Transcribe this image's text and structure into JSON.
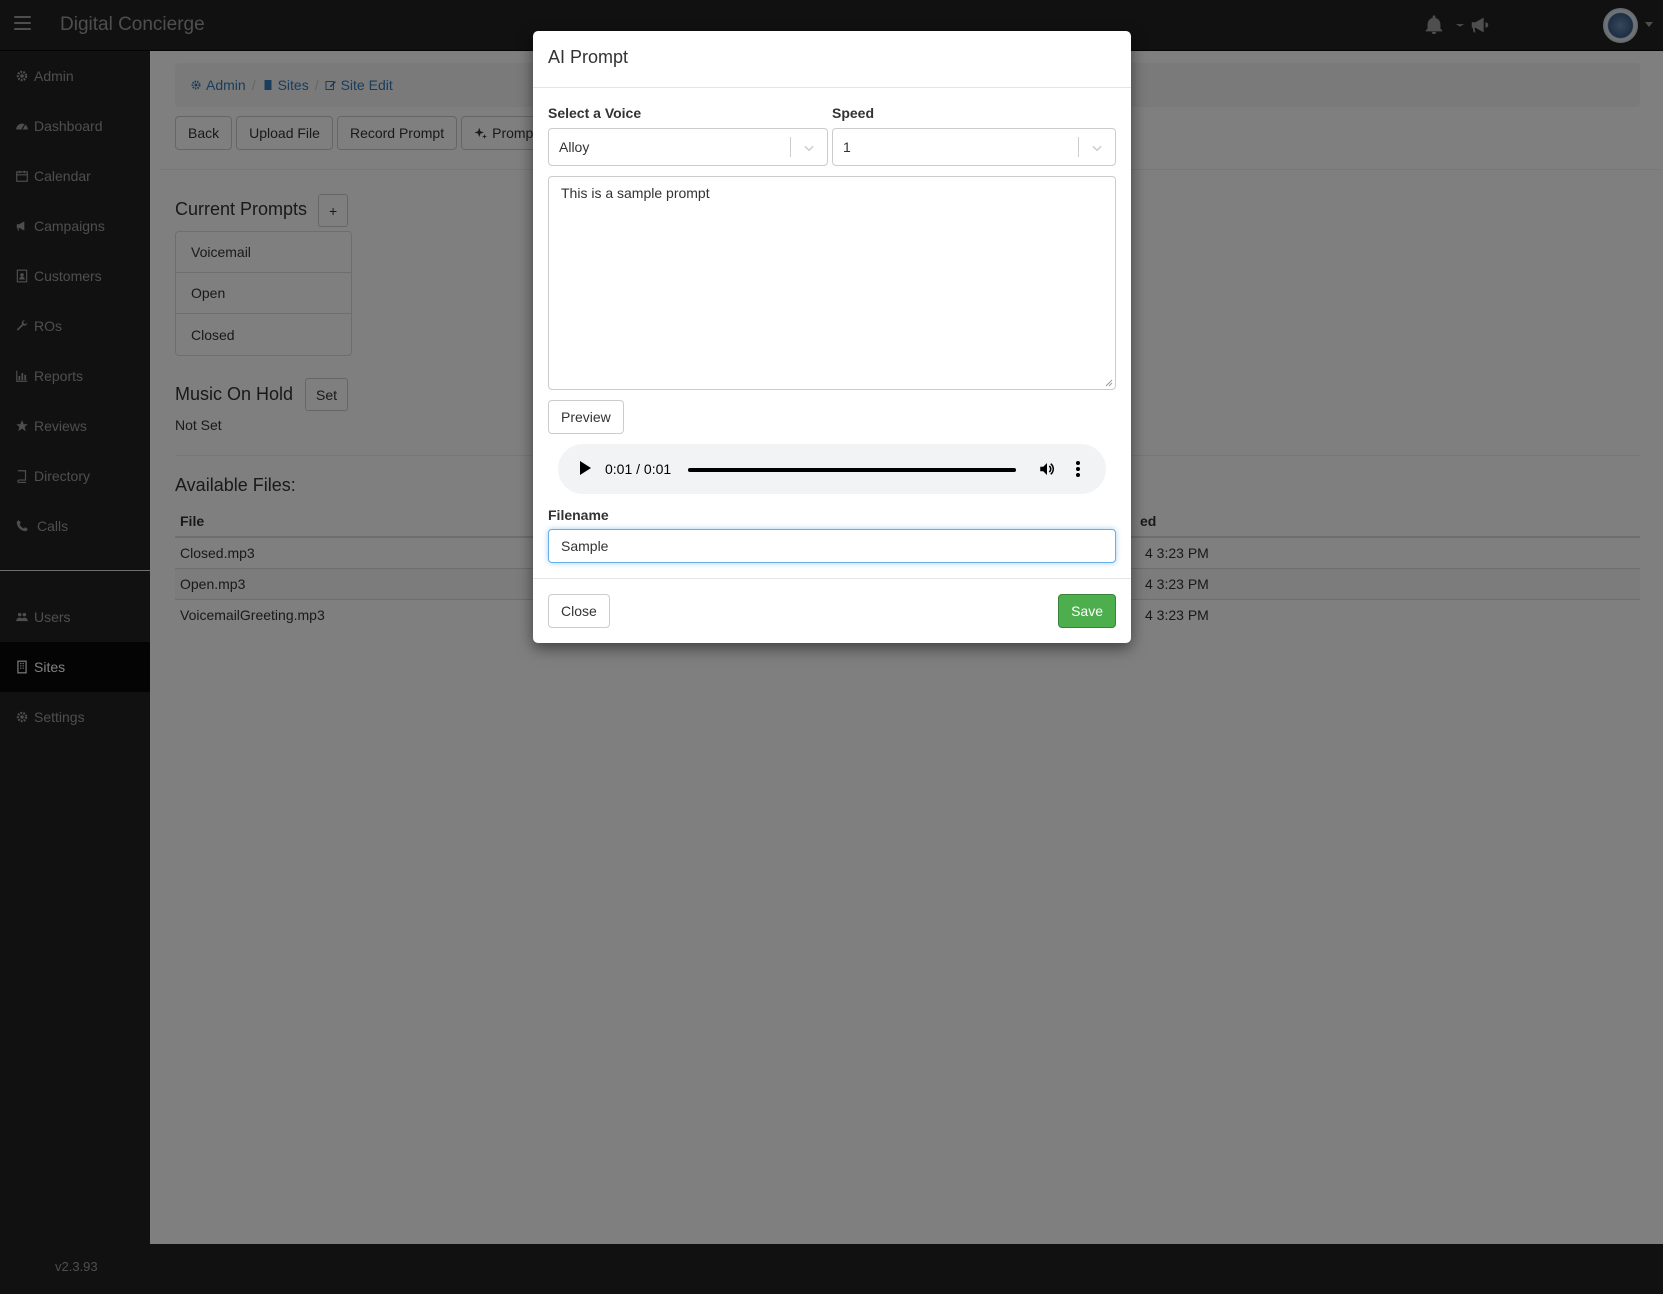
{
  "app": {
    "brand": "Digital Concierge",
    "version": "v2.3.93"
  },
  "sidebar": {
    "items": [
      {
        "label": "Admin",
        "icon": "gear-icon"
      },
      {
        "label": "Dashboard",
        "icon": "dashboard-icon"
      },
      {
        "label": "Calendar",
        "icon": "calendar-icon"
      },
      {
        "label": "Campaigns",
        "icon": "megaphone-icon"
      },
      {
        "label": "Customers",
        "icon": "contact-card-icon"
      },
      {
        "label": "ROs",
        "icon": "wrench-icon"
      },
      {
        "label": "Reports",
        "icon": "bar-chart-icon"
      },
      {
        "label": "Reviews",
        "icon": "star-icon"
      },
      {
        "label": "Directory",
        "icon": "book-icon"
      },
      {
        "label": "Calls",
        "icon": "phone-icon"
      },
      {
        "label": "Users",
        "icon": "users-icon"
      },
      {
        "label": "Sites",
        "icon": "building-icon",
        "active": true
      },
      {
        "label": "Settings",
        "icon": "gear-icon"
      }
    ]
  },
  "breadcrumb": {
    "admin": "Admin",
    "sites": "Sites",
    "site_edit": "Site Edit"
  },
  "toolbar": {
    "back": "Back",
    "upload_file": "Upload File",
    "record_prompt": "Record Prompt",
    "ai_prompt": "Promp"
  },
  "current_prompts": {
    "title": "Current Prompts",
    "add": "+",
    "items": [
      "Voicemail",
      "Open",
      "Closed"
    ]
  },
  "music_on_hold": {
    "title": "Music On Hold",
    "set": "Set",
    "value": "Not Set"
  },
  "available_files": {
    "title": "Available Files:",
    "columns": {
      "file": "File",
      "modified": "ed"
    },
    "rows": [
      {
        "file": "Closed.mp3",
        "modified": "4 3:23 PM"
      },
      {
        "file": "Open.mp3",
        "modified": "4 3:23 PM"
      },
      {
        "file": "VoicemailGreeting.mp3",
        "modified": "4 3:23 PM"
      }
    ]
  },
  "modal": {
    "title": "AI Prompt",
    "voice_label": "Select a Voice",
    "voice_value": "Alloy",
    "speed_label": "Speed",
    "speed_value": "1",
    "prompt_text": "This is a sample prompt",
    "preview": "Preview",
    "audio": {
      "time": "0:01 / 0:01",
      "progress": 1.0
    },
    "filename_label": "Filename",
    "filename_value": "Sample",
    "close": "Close",
    "save": "Save"
  },
  "colors": {
    "navbar": "#222222",
    "save_green": "#4cae4c",
    "link_blue": "#337ab7"
  }
}
